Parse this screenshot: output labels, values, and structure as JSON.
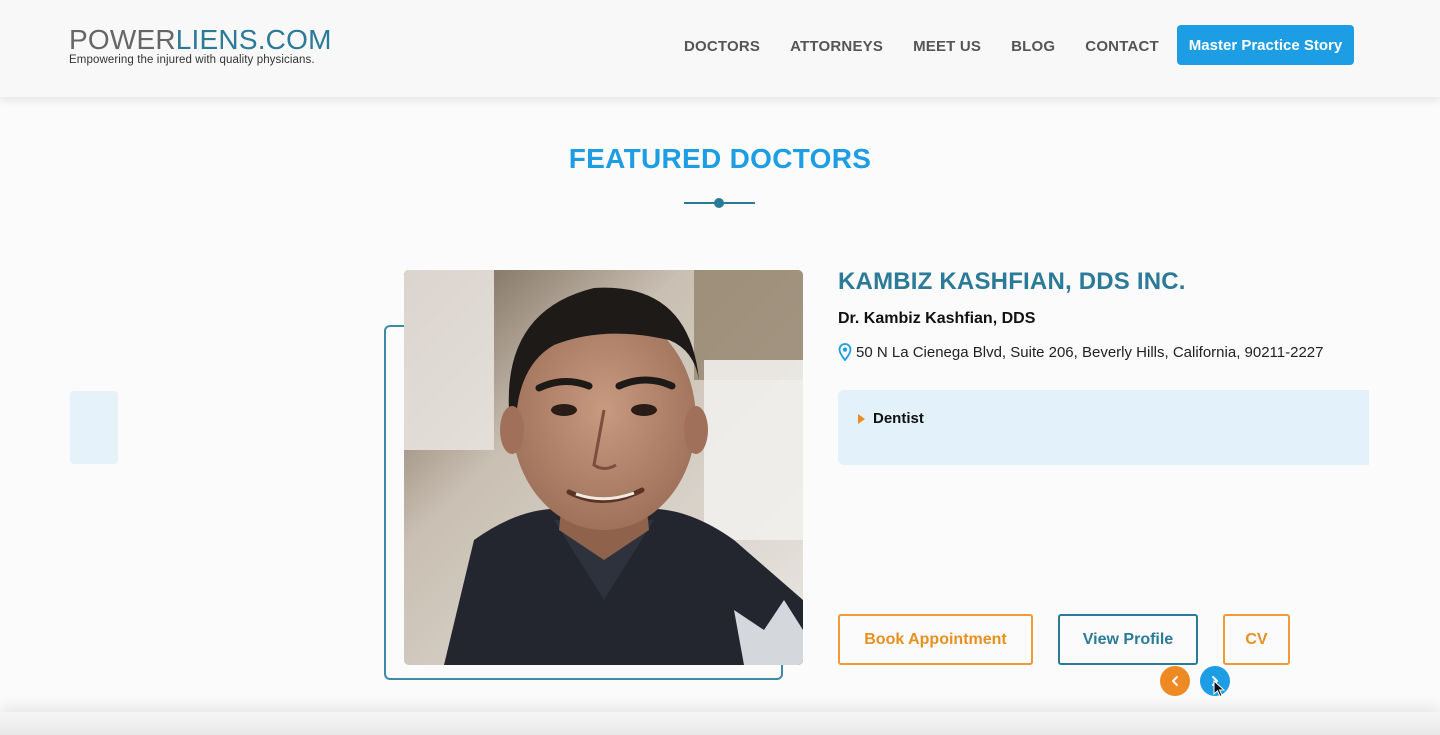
{
  "header": {
    "logo_power": "POWER",
    "logo_liens": "LIENS.COM",
    "tagline": "Empowering the injured with quality physicians.",
    "nav": [
      "DOCTORS",
      "ATTORNEYS",
      "MEET US",
      "BLOG",
      "CONTACT"
    ],
    "cta_label": "Master Practice Story"
  },
  "section": {
    "title": "FEATURED DOCTORS"
  },
  "doctor": {
    "practice_name": "KAMBIZ KASHFIAN, DDS INC.",
    "person": "Dr. Kambiz Kashfian, DDS",
    "address": "50 N La Cienega Blvd, Suite 206, Beverly Hills, California, 90211-2227",
    "specialty": "Dentist",
    "buttons": {
      "book": "Book Appointment",
      "view": "View Profile",
      "cv": "CV"
    }
  },
  "colors": {
    "accent_blue": "#1c9de4",
    "teal": "#2b7a98",
    "orange": "#ee8a23"
  },
  "icons": [
    "location-pin-icon",
    "chevron-left-icon",
    "chevron-right-icon",
    "caret-right-icon",
    "mouse-cursor-icon"
  ]
}
